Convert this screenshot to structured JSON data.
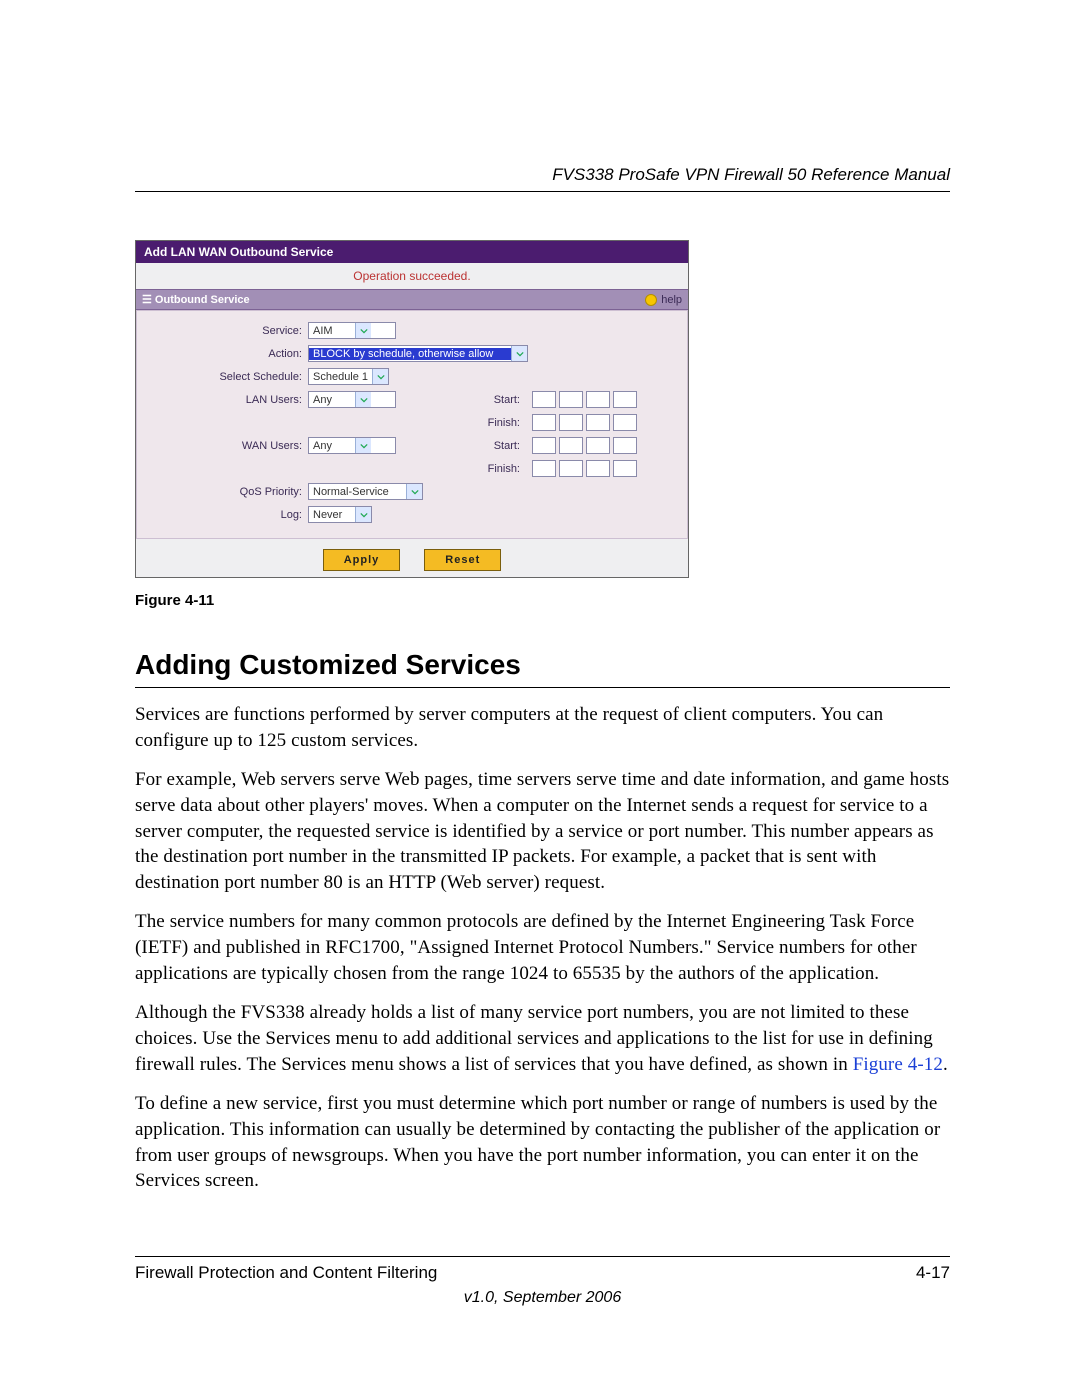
{
  "header": {
    "running_head": "FVS338 ProSafe VPN Firewall 50 Reference Manual"
  },
  "figure": {
    "caption": "Figure 4-11",
    "router_ui": {
      "title": "Add LAN WAN Outbound Service",
      "status_message": "Operation succeeded.",
      "section_title": "Outbound Service",
      "help_label": "help",
      "fields": {
        "service_label": "Service:",
        "service_value": "AIM",
        "action_label": "Action:",
        "action_value": "BLOCK by schedule, otherwise allow",
        "schedule_label": "Select Schedule:",
        "schedule_value": "Schedule 1",
        "lan_users_label": "LAN Users:",
        "lan_users_value": "Any",
        "wan_users_label": "WAN Users:",
        "wan_users_value": "Any",
        "qos_label": "QoS Priority:",
        "qos_value": "Normal-Service",
        "log_label": "Log:",
        "log_value": "Never",
        "start_label": "Start:",
        "finish_label": "Finish:"
      },
      "buttons": {
        "apply": "Apply",
        "reset": "Reset"
      }
    }
  },
  "section_heading": "Adding Customized Services",
  "paragraphs": {
    "p1": "Services are functions performed by server computers at the request of client computers. You can configure up to 125 custom services.",
    "p2": "For example, Web servers serve Web pages, time servers serve time and date information, and game hosts serve data about other players' moves. When a computer on the Internet sends a request for service to a server computer, the requested service is identified by a service or port number. This number appears as the destination port number in the transmitted IP packets. For example, a packet that is sent with destination port number 80 is an HTTP (Web server) request.",
    "p3": "The service numbers for many common protocols are defined by the Internet Engineering Task Force (IETF) and published in RFC1700, \"Assigned Internet Protocol Numbers.\" Service numbers for other applications are typically chosen from the range 1024 to 65535 by the authors of the application.",
    "p4_a": "Although the FVS338 already holds a list of many service port numbers, you are not limited to these choices. Use the Services menu to add additional services and applications to the list for use in defining firewall rules. The Services menu shows a list of services that you have defined, as shown in ",
    "p4_link": "Figure 4-12",
    "p4_b": ".",
    "p5": "To define a new service, first you must determine which port number or range of numbers is used by the application. This information can usually be determined by contacting the publisher of the application or from user groups of newsgroups. When you have the port number information, you can enter it on the Services screen."
  },
  "footer": {
    "chapter": "Firewall Protection and Content Filtering",
    "page": "4-17",
    "version": "v1.0, September 2006"
  }
}
